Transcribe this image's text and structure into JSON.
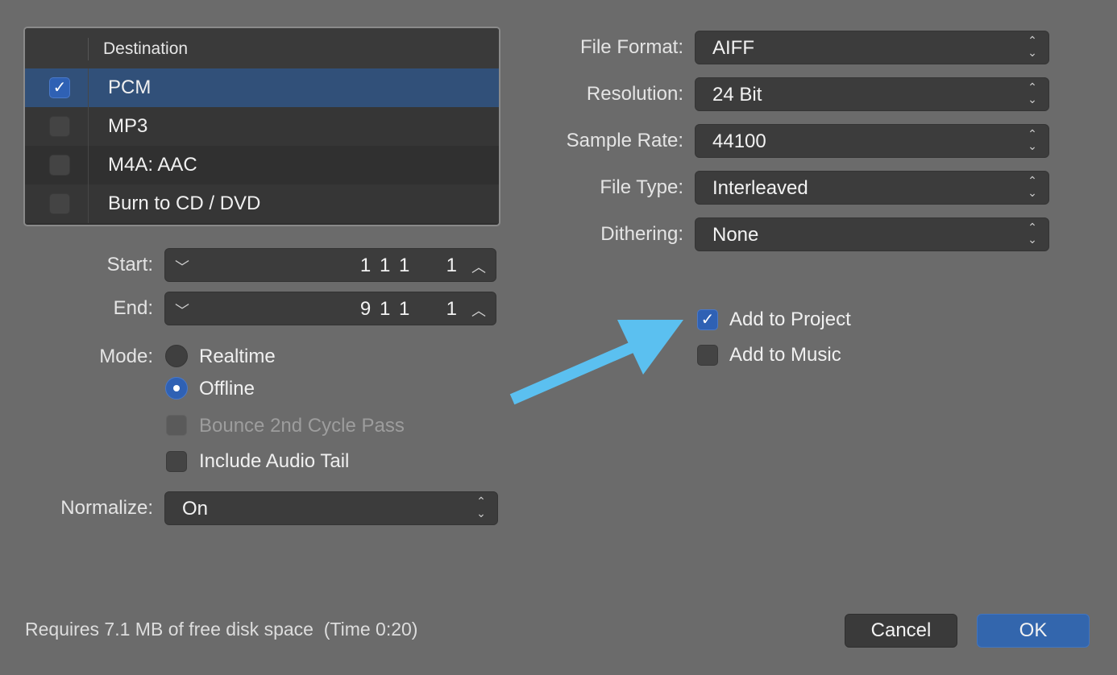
{
  "destination": {
    "header": "Destination",
    "items": [
      {
        "label": "PCM",
        "checked": true
      },
      {
        "label": "MP3",
        "checked": false
      },
      {
        "label": "M4A: AAC",
        "checked": false
      },
      {
        "label": "Burn to CD / DVD",
        "checked": false
      }
    ]
  },
  "range": {
    "start_label": "Start:",
    "start_value": "1 1 1     1",
    "end_label": "End:",
    "end_value": "9 1 1     1"
  },
  "mode": {
    "label": "Mode:",
    "options": [
      {
        "label": "Realtime",
        "selected": false
      },
      {
        "label": "Offline",
        "selected": true
      }
    ],
    "bounce_2nd_cycle": {
      "label": "Bounce 2nd Cycle Pass",
      "checked": false,
      "disabled": true
    },
    "include_audio_tail": {
      "label": "Include Audio Tail",
      "checked": false
    }
  },
  "normalize": {
    "label": "Normalize:",
    "value": "On"
  },
  "format": {
    "file_format": {
      "label": "File Format:",
      "value": "AIFF"
    },
    "resolution": {
      "label": "Resolution:",
      "value": "24 Bit"
    },
    "sample_rate": {
      "label": "Sample Rate:",
      "value": "44100"
    },
    "file_type": {
      "label": "File Type:",
      "value": "Interleaved"
    },
    "dithering": {
      "label": "Dithering:",
      "value": "None"
    }
  },
  "add_to": {
    "project": {
      "label": "Add to Project",
      "checked": true
    },
    "music": {
      "label": "Add to Music",
      "checked": false
    }
  },
  "footer": {
    "disk_space": "Requires 7.1 MB of free disk space  (Time 0:20)"
  },
  "buttons": {
    "cancel": "Cancel",
    "ok": "OK"
  },
  "annotation": {
    "arrow_color": "#5bc0f0"
  },
  "colors": {
    "accent": "#2f61b4",
    "selected_row": "#315079",
    "background": "#6b6b6b"
  }
}
